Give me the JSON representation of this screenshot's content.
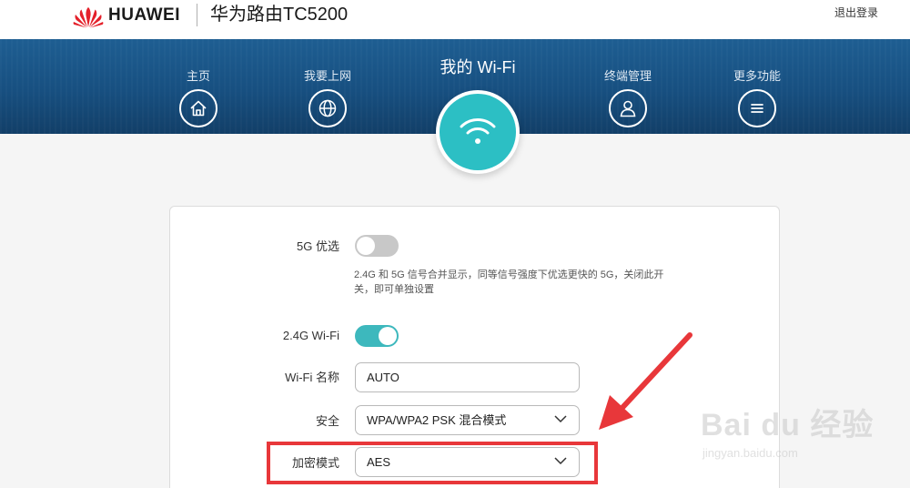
{
  "header": {
    "brand": "HUAWEI",
    "product": "华为路由TC5200",
    "logout": "退出登录"
  },
  "nav": {
    "items": [
      {
        "label": "主页",
        "icon": "home-icon"
      },
      {
        "label": "我要上网",
        "icon": "globe-icon"
      },
      {
        "label": "我的 Wi-Fi",
        "icon": "wifi-icon",
        "active": true
      },
      {
        "label": "终端管理",
        "icon": "user-icon"
      },
      {
        "label": "更多功能",
        "icon": "menu-icon"
      }
    ]
  },
  "settings": {
    "band_steering": {
      "label": "5G 优选",
      "enabled": false,
      "description": "2.4G 和 5G 信号合并显示，同等信号强度下优选更快的 5G，关闭此开关，即可单独设置"
    },
    "wifi_24g": {
      "label": "2.4G Wi-Fi",
      "enabled": true
    },
    "ssid": {
      "label": "Wi-Fi 名称",
      "value": "AUTO"
    },
    "security": {
      "label": "安全",
      "value": "WPA/WPA2 PSK 混合模式"
    },
    "encryption": {
      "label": "加密模式",
      "value": "AES"
    }
  },
  "watermark": {
    "text": "Bai du 经验",
    "sub": "jingyan.baidu.com"
  },
  "colors": {
    "accent": "#2cbfc4",
    "banner": "#174f80",
    "annotation": "#e8373a"
  }
}
